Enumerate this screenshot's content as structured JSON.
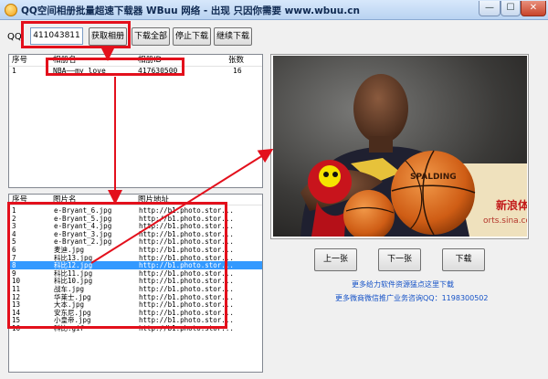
{
  "window": {
    "title": "QQ空间相册批量超速下载器  WBuu 网络  -  出现 只因你需要 www.wbuu.cn",
    "min_glyph": "—",
    "max_glyph": "☐",
    "close_glyph": "✕"
  },
  "toolbar": {
    "qq_label": "QQ:",
    "qq_value": "411043811",
    "get_albums": "获取相册",
    "download_all": "下载全部",
    "stop_download": "停止下载",
    "continue_download": "继续下载"
  },
  "album_list": {
    "headers": [
      "序号",
      "相册名",
      "相册ID",
      "张数"
    ],
    "rows": [
      {
        "index": "1",
        "name": "NBA——my love",
        "id": "417630500",
        "count": "16"
      }
    ]
  },
  "photo_list": {
    "headers": [
      "序号",
      "图片名",
      "图片地址"
    ],
    "rows": [
      {
        "index": "1",
        "name": "e-Bryant_6.jpg",
        "url": "http://b1.photo.stor..."
      },
      {
        "index": "2",
        "name": "e-Bryant_5.jpg",
        "url": "http://b1.photo.stor..."
      },
      {
        "index": "3",
        "name": "e-Bryant_4.jpg",
        "url": "http://b1.photo.stor..."
      },
      {
        "index": "4",
        "name": "e-Bryant_3.jpg",
        "url": "http://b1.photo.stor..."
      },
      {
        "index": "5",
        "name": "e-Bryant_2.jpg",
        "url": "http://b1.photo.stor..."
      },
      {
        "index": "6",
        "name": "麦迪.jpg",
        "url": "http://b1.photo.stor..."
      },
      {
        "index": "7",
        "name": "科比13.jpg",
        "url": "http://b1.photo.stor..."
      },
      {
        "index": "8",
        "name": "科比12.jpg",
        "url": "http://b1.photo.stor..."
      },
      {
        "index": "9",
        "name": "科比11.jpg",
        "url": "http://b1.photo.stor..."
      },
      {
        "index": "10",
        "name": "科比10.jpg",
        "url": "http://b1.photo.stor..."
      },
      {
        "index": "11",
        "name": "战车.jpg",
        "url": "http://b1.photo.stor..."
      },
      {
        "index": "12",
        "name": "华莱士.jpg",
        "url": "http://b1.photo.stor..."
      },
      {
        "index": "13",
        "name": "大本.jpg",
        "url": "http://b1.photo.stor..."
      },
      {
        "index": "14",
        "name": "安东尼.jpg",
        "url": "http://b1.photo.stor..."
      },
      {
        "index": "15",
        "name": "小皇帝.jpg",
        "url": "http://b1.photo.stor..."
      },
      {
        "index": "16",
        "name": "科比.gif",
        "url": "http://b1.photo.stor..."
      }
    ],
    "selected_index": 7
  },
  "photo_panel": {
    "banner_text": "新浪体",
    "banner_url": "orts.sina.co",
    "ball_text": "SPALDING",
    "prev": "上一张",
    "next": "下一张",
    "download": "下载",
    "link_more": "更多给力软件资源猛点这里下载",
    "link_contact": "更多微商微信推广业务咨询QQ：1198300502"
  },
  "colors": {
    "highlight_red": "#e3101c",
    "selection_blue": "#3399ff",
    "link_blue": "#1552c7"
  }
}
